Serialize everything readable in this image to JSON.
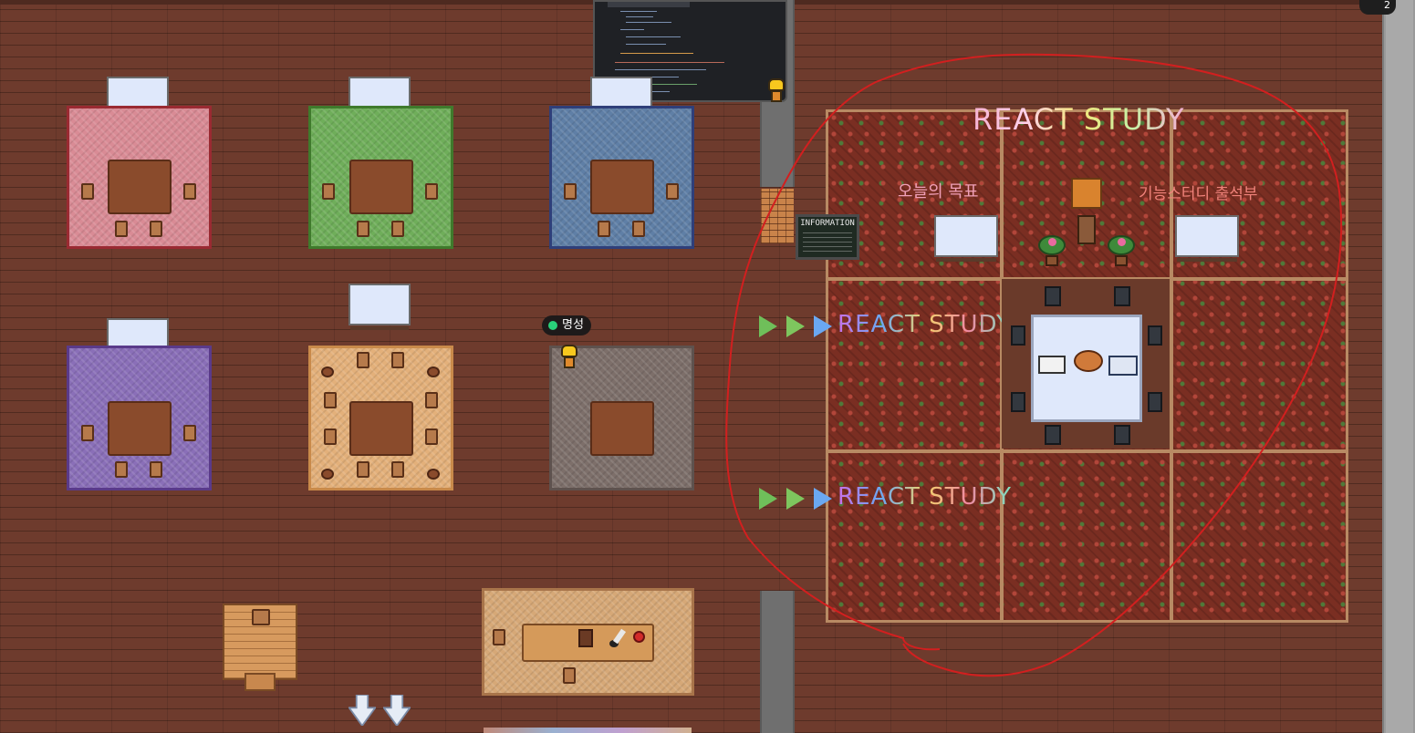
{
  "player": {
    "name": "명성",
    "status_color": "#29d17a"
  },
  "zone": {
    "title": "REACT STUDY",
    "left_label": "오늘의 목표",
    "right_label": "기능스터디 출석부",
    "row_labels": [
      "REACT STUDY",
      "REACT STUDY"
    ]
  },
  "info_board": {
    "title": "INFORMATION"
  },
  "corner_badge": "2",
  "colors": {
    "floor": "#6e3b2d",
    "annotation": "#d21f1f",
    "rug_pink": "#d98b95",
    "rug_green": "#6fae5a",
    "rug_blue": "#5f7fa6",
    "rug_purple": "#8a6fb8",
    "rug_tan": "#e3b07a",
    "rug_gray": "#7d6f6a"
  },
  "icons": [
    "whiteboard-icon",
    "chair-icon",
    "table-icon",
    "plant-icon",
    "info-board-icon",
    "down-arrow-icon",
    "play-arrow-icon"
  ]
}
